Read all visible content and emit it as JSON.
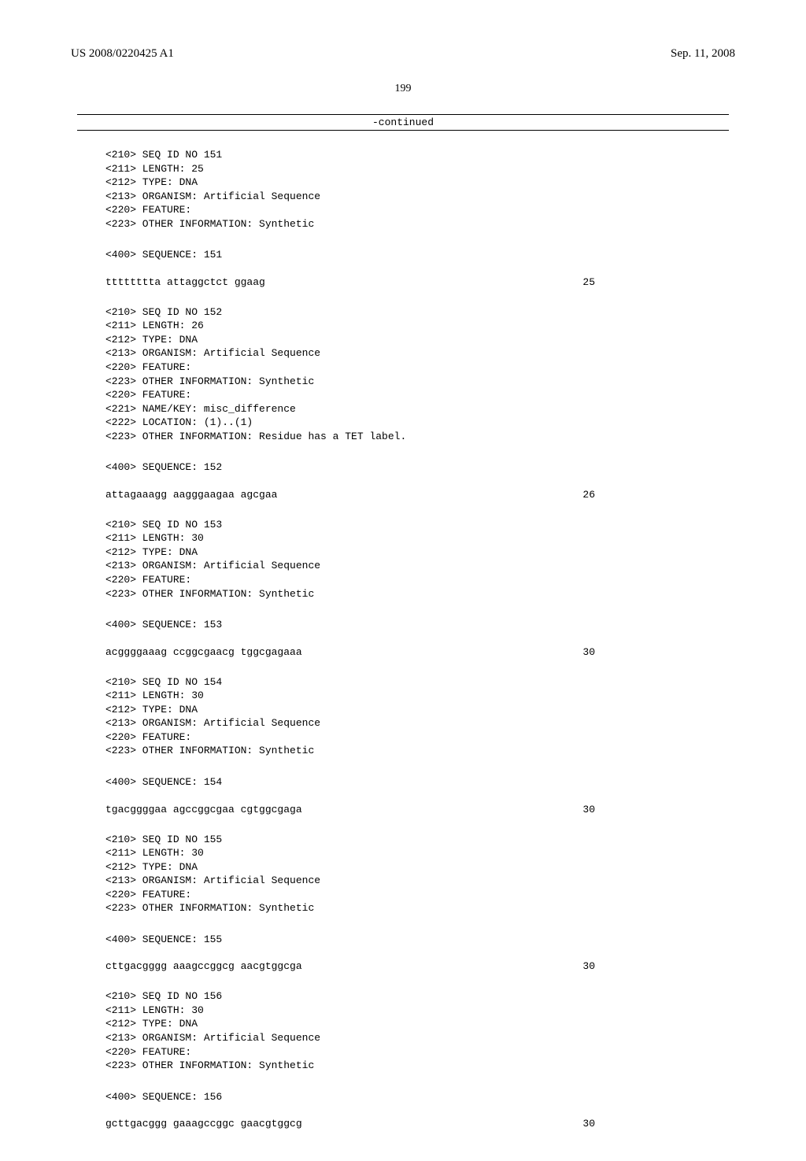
{
  "header": {
    "pub_number": "US 2008/0220425 A1",
    "date": "Sep. 11, 2008"
  },
  "page_number": "199",
  "continued_label": "-continued",
  "entries": [
    {
      "meta": "<210> SEQ ID NO 151\n<211> LENGTH: 25\n<212> TYPE: DNA\n<213> ORGANISM: Artificial Sequence\n<220> FEATURE:\n<223> OTHER INFORMATION: Synthetic",
      "seq_header": "<400> SEQUENCE: 151",
      "sequence": "tttttttta attaggctct ggaag",
      "length_label": "25"
    },
    {
      "meta": "<210> SEQ ID NO 152\n<211> LENGTH: 26\n<212> TYPE: DNA\n<213> ORGANISM: Artificial Sequence\n<220> FEATURE:\n<223> OTHER INFORMATION: Synthetic\n<220> FEATURE:\n<221> NAME/KEY: misc_difference\n<222> LOCATION: (1)..(1)\n<223> OTHER INFORMATION: Residue has a TET label.",
      "seq_header": "<400> SEQUENCE: 152",
      "sequence": "attagaaagg aagggaagaa agcgaa",
      "length_label": "26"
    },
    {
      "meta": "<210> SEQ ID NO 153\n<211> LENGTH: 30\n<212> TYPE: DNA\n<213> ORGANISM: Artificial Sequence\n<220> FEATURE:\n<223> OTHER INFORMATION: Synthetic",
      "seq_header": "<400> SEQUENCE: 153",
      "sequence": "acggggaaag ccggcgaacg tggcgagaaa",
      "length_label": "30"
    },
    {
      "meta": "<210> SEQ ID NO 154\n<211> LENGTH: 30\n<212> TYPE: DNA\n<213> ORGANISM: Artificial Sequence\n<220> FEATURE:\n<223> OTHER INFORMATION: Synthetic",
      "seq_header": "<400> SEQUENCE: 154",
      "sequence": "tgacggggaa agccggcgaa cgtggcgaga",
      "length_label": "30"
    },
    {
      "meta": "<210> SEQ ID NO 155\n<211> LENGTH: 30\n<212> TYPE: DNA\n<213> ORGANISM: Artificial Sequence\n<220> FEATURE:\n<223> OTHER INFORMATION: Synthetic",
      "seq_header": "<400> SEQUENCE: 155",
      "sequence": "cttgacgggg aaagccggcg aacgtggcga",
      "length_label": "30"
    },
    {
      "meta": "<210> SEQ ID NO 156\n<211> LENGTH: 30\n<212> TYPE: DNA\n<213> ORGANISM: Artificial Sequence\n<220> FEATURE:\n<223> OTHER INFORMATION: Synthetic",
      "seq_header": "<400> SEQUENCE: 156",
      "sequence": "gcttgacggg gaaagccggc gaacgtggcg",
      "length_label": "30"
    }
  ]
}
